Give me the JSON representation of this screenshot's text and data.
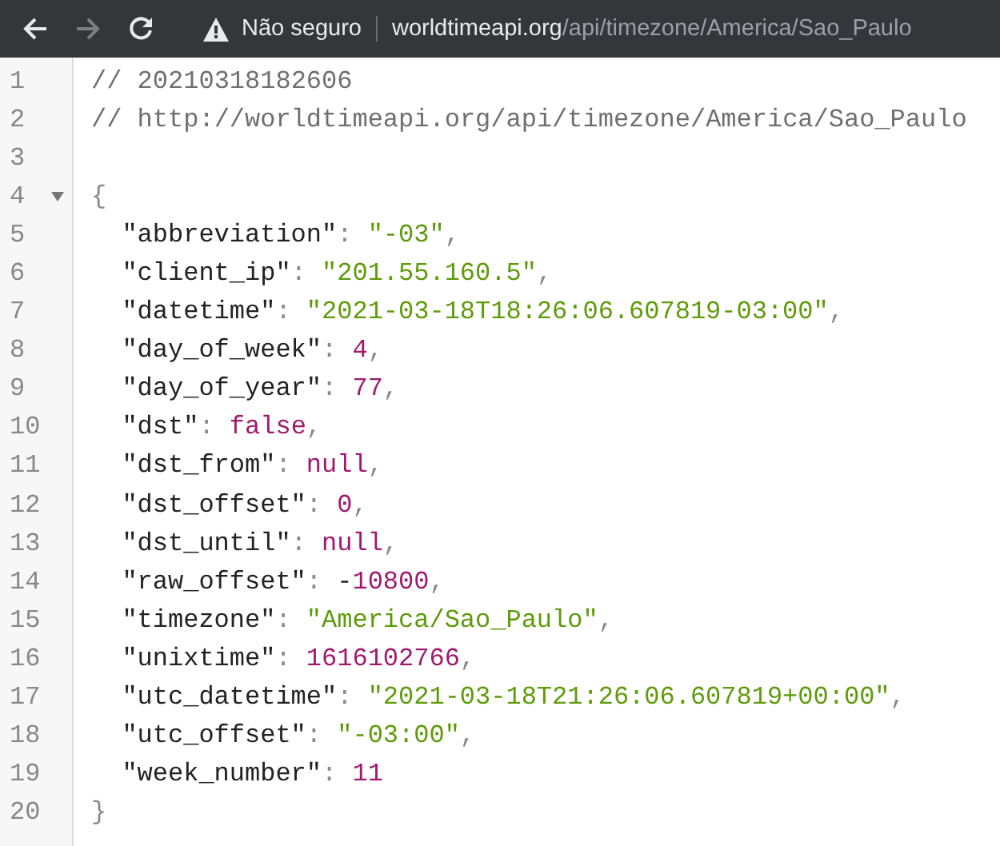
{
  "toolbar": {
    "buttons": [
      {
        "kind": "back",
        "disabled": false
      },
      {
        "kind": "forward",
        "disabled": true
      },
      {
        "kind": "reload",
        "disabled": false
      }
    ],
    "security": {
      "label": "Não seguro"
    },
    "url": {
      "host": "worldtimeapi.org",
      "path": "/api/timezone/America/Sao_Paulo"
    }
  },
  "lines": [
    {
      "number": "1",
      "tokens": [
        {
          "kind": "comment",
          "text": "// 20210318182606"
        }
      ]
    },
    {
      "number": "2",
      "tokens": [
        {
          "kind": "comment",
          "text": "// http://worldtimeapi.org/api/timezone/America/Sao_Paulo"
        }
      ]
    },
    {
      "number": "3"
    },
    {
      "number": "4",
      "foldable": true,
      "tokens": [
        {
          "kind": "punct",
          "text": "{"
        }
      ],
      "children": [
        {
          "number": "5",
          "tokens": [
            {
              "kind": "key",
              "text": "\"abbreviation\""
            },
            {
              "kind": "punct",
              "text": ": "
            },
            {
              "kind": "string",
              "text": "\"-03\""
            },
            {
              "kind": "punct",
              "text": ","
            }
          ]
        },
        {
          "number": "6",
          "tokens": [
            {
              "kind": "key",
              "text": "\"client_ip\""
            },
            {
              "kind": "punct",
              "text": ": "
            },
            {
              "kind": "string",
              "text": "\"201.55.160.5\""
            },
            {
              "kind": "punct",
              "text": ","
            }
          ]
        },
        {
          "number": "7",
          "tokens": [
            {
              "kind": "key",
              "text": "\"datetime\""
            },
            {
              "kind": "punct",
              "text": ": "
            },
            {
              "kind": "string",
              "text": "\"2021-03-18T18:26:06.607819-03:00\""
            },
            {
              "kind": "punct",
              "text": ","
            }
          ]
        },
        {
          "number": "8",
          "tokens": [
            {
              "kind": "key",
              "text": "\"day_of_week\""
            },
            {
              "kind": "punct",
              "text": ": "
            },
            {
              "kind": "number",
              "text": "4"
            },
            {
              "kind": "punct",
              "text": ","
            }
          ]
        },
        {
          "number": "9",
          "tokens": [
            {
              "kind": "key",
              "text": "\"day_of_year\""
            },
            {
              "kind": "punct",
              "text": ": "
            },
            {
              "kind": "number",
              "text": "77"
            },
            {
              "kind": "punct",
              "text": ","
            }
          ]
        },
        {
          "number": "10",
          "tokens": [
            {
              "kind": "key",
              "text": "\"dst\""
            },
            {
              "kind": "punct",
              "text": ": "
            },
            {
              "kind": "keyword",
              "text": "false"
            },
            {
              "kind": "punct",
              "text": ","
            }
          ]
        },
        {
          "number": "11",
          "tokens": [
            {
              "kind": "key",
              "text": "\"dst_from\""
            },
            {
              "kind": "punct",
              "text": ": "
            },
            {
              "kind": "keyword",
              "text": "null"
            },
            {
              "kind": "punct",
              "text": ","
            }
          ]
        },
        {
          "number": "12",
          "tokens": [
            {
              "kind": "key",
              "text": "\"dst_offset\""
            },
            {
              "kind": "punct",
              "text": ": "
            },
            {
              "kind": "number",
              "text": "0"
            },
            {
              "kind": "punct",
              "text": ","
            }
          ]
        },
        {
          "number": "13",
          "tokens": [
            {
              "kind": "key",
              "text": "\"dst_until\""
            },
            {
              "kind": "punct",
              "text": ": "
            },
            {
              "kind": "keyword",
              "text": "null"
            },
            {
              "kind": "punct",
              "text": ","
            }
          ]
        },
        {
          "number": "14",
          "tokens": [
            {
              "kind": "key",
              "text": "\"raw_offset\""
            },
            {
              "kind": "punct",
              "text": ": "
            },
            {
              "kind": "plain",
              "text": "-"
            },
            {
              "kind": "number",
              "text": "10800"
            },
            {
              "kind": "punct",
              "text": ","
            }
          ]
        },
        {
          "number": "15",
          "tokens": [
            {
              "kind": "key",
              "text": "\"timezone\""
            },
            {
              "kind": "punct",
              "text": ": "
            },
            {
              "kind": "string",
              "text": "\"America/Sao_Paulo\""
            },
            {
              "kind": "punct",
              "text": ","
            }
          ]
        },
        {
          "number": "16",
          "tokens": [
            {
              "kind": "key",
              "text": "\"unixtime\""
            },
            {
              "kind": "punct",
              "text": ": "
            },
            {
              "kind": "number",
              "text": "1616102766"
            },
            {
              "kind": "punct",
              "text": ","
            }
          ]
        },
        {
          "number": "17",
          "tokens": [
            {
              "kind": "key",
              "text": "\"utc_datetime\""
            },
            {
              "kind": "punct",
              "text": ": "
            },
            {
              "kind": "string",
              "text": "\"2021-03-18T21:26:06.607819+00:00\""
            },
            {
              "kind": "punct",
              "text": ","
            }
          ]
        },
        {
          "number": "18",
          "tokens": [
            {
              "kind": "key",
              "text": "\"utc_offset\""
            },
            {
              "kind": "punct",
              "text": ": "
            },
            {
              "kind": "string",
              "text": "\"-03:00\""
            },
            {
              "kind": "punct",
              "text": ","
            }
          ]
        },
        {
          "number": "19",
          "tokens": [
            {
              "kind": "key",
              "text": "\"week_number\""
            },
            {
              "kind": "punct",
              "text": ": "
            },
            {
              "kind": "number",
              "text": "11"
            }
          ]
        }
      ]
    },
    {
      "number": "20",
      "tokens": [
        {
          "kind": "punct",
          "text": "}"
        }
      ]
    }
  ]
}
